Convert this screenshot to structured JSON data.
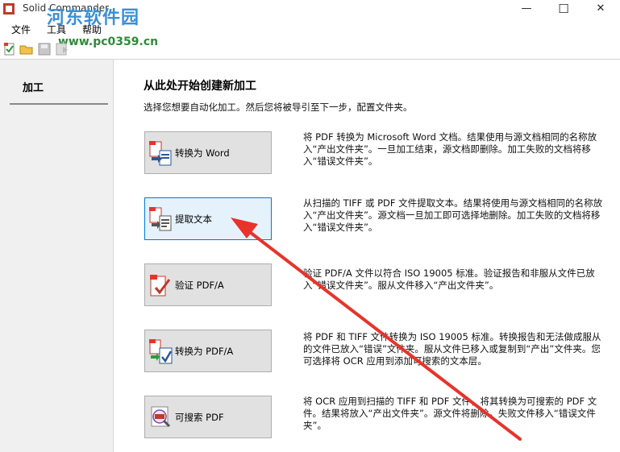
{
  "window": {
    "title": "Solid Commander",
    "minimize": "—",
    "maximize": "☐",
    "close": "✕"
  },
  "watermark": {
    "name": "河东软件园",
    "url": "www.pc0359.cn"
  },
  "menu": [
    "文件",
    "工具",
    "帮助"
  ],
  "sidebar": {
    "tab": "加工"
  },
  "main": {
    "heading": "从此处开始创建新加工",
    "subheading": "选择您想要自动化加工。然后您将被导引至下一步，配置文件夹。",
    "actions": [
      {
        "label": "转换为 Word",
        "desc": "将 PDF 转换为 Microsoft Word 文档。结果使用与源文档相同的名称放入“产出文件夹”。一旦加工结束，源文档即删除。加工失败的文档将移入“错误文件夹”。",
        "active": false
      },
      {
        "label": "提取文本",
        "desc": "从扫描的 TIFF 或 PDF 文件提取文本。结果将使用与源文档相同的名称放入“产出文件夹”。源文档一旦加工即可选择地删除。加工失败的文档将移入“错误文件夹”。",
        "active": true
      },
      {
        "label": "验证 PDF/A",
        "desc": "验证 PDF/A 文件以符合 ISO 19005 标准。验证报告和非服从文件已放入“错误文件夹”。服从文件移入“产出文件夹”。",
        "active": false
      },
      {
        "label": "转换为 PDF/A",
        "desc": "将 PDF 和 TIFF 文件转换为 ISO 19005 标准。转换报告和无法做成服从的文件已放入“错误”文件夹。服从文件已移入或复制到“产出”文件夹。您可选择将 OCR 应用到添加可搜索的文本层。",
        "active": false
      },
      {
        "label": "可搜索 PDF",
        "desc": "将 OCR 应用到扫描的 TIFF 和 PDF 文件，将其转换为可搜索的 PDF 文件。结果将放入“产出文件夹”。源文件将删除。失败文件移入“错误文件夹”。",
        "active": false
      }
    ]
  },
  "colors": {
    "annotation_arrow": "#e8332a",
    "active_border": "#0078d7",
    "watermark_blue": "#3a8fd8",
    "watermark_green": "#2f8a3a"
  }
}
